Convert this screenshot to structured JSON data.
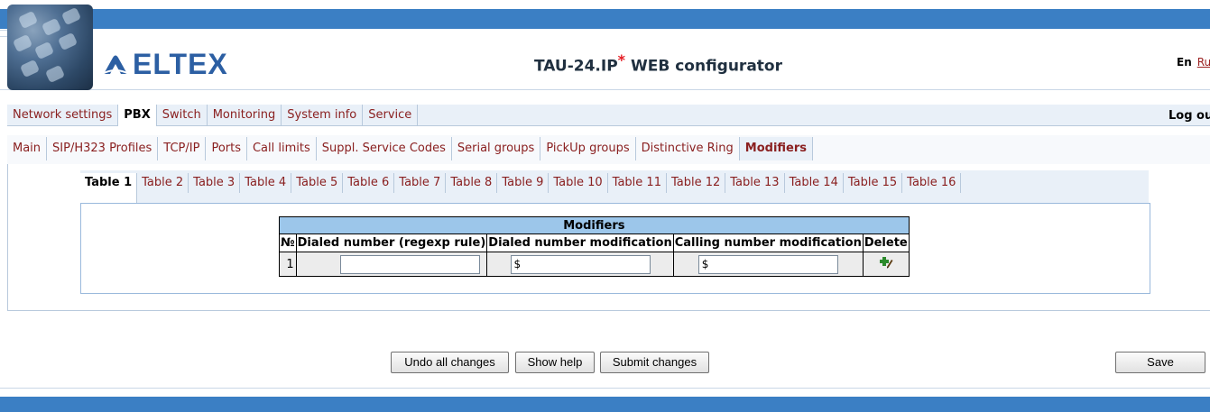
{
  "header": {
    "logo_text": "ELTEX",
    "title": "TAU-24.IP",
    "title_mark": "*",
    "title_suffix": " WEB configurator",
    "lang_en": "En",
    "lang_ru": "Ru"
  },
  "top_nav": {
    "items": [
      "Network settings",
      "PBX",
      "Switch",
      "Monitoring",
      "System info",
      "Service"
    ],
    "active": "PBX",
    "logout": "Log out"
  },
  "sub_nav": {
    "items": [
      "Main",
      "SIP/H323 Profiles",
      "TCP/IP",
      "Ports",
      "Call limits",
      "Suppl. Service Codes",
      "Serial groups",
      "PickUp groups",
      "Distinctive Ring",
      "Modifiers"
    ],
    "active": "Modifiers"
  },
  "table_tabs": {
    "items": [
      "Table 1",
      "Table 2",
      "Table 3",
      "Table 4",
      "Table 5",
      "Table 6",
      "Table 7",
      "Table 8",
      "Table 9",
      "Table 10",
      "Table 11",
      "Table 12",
      "Table 13",
      "Table 14",
      "Table 15",
      "Table 16"
    ],
    "active": "Table 1"
  },
  "modifiers": {
    "caption": "Modifiers",
    "columns": [
      "№",
      "Dialed number (regexp rule)",
      "Dialed number modification",
      "Calling number modification",
      "Delete"
    ],
    "rows": [
      {
        "num": "1",
        "regexp": "",
        "dialed_mod": "$",
        "calling_mod": "$"
      }
    ]
  },
  "icons": {
    "delete": "add-delete-icon"
  },
  "buttons": {
    "undo": "Undo all changes",
    "help": "Show help",
    "submit": "Submit changes",
    "save": "Save"
  },
  "colors": {
    "header_blue": "#3b7fc4",
    "grid_caption": "#9cc6ea",
    "link_red": "#8a2020"
  }
}
